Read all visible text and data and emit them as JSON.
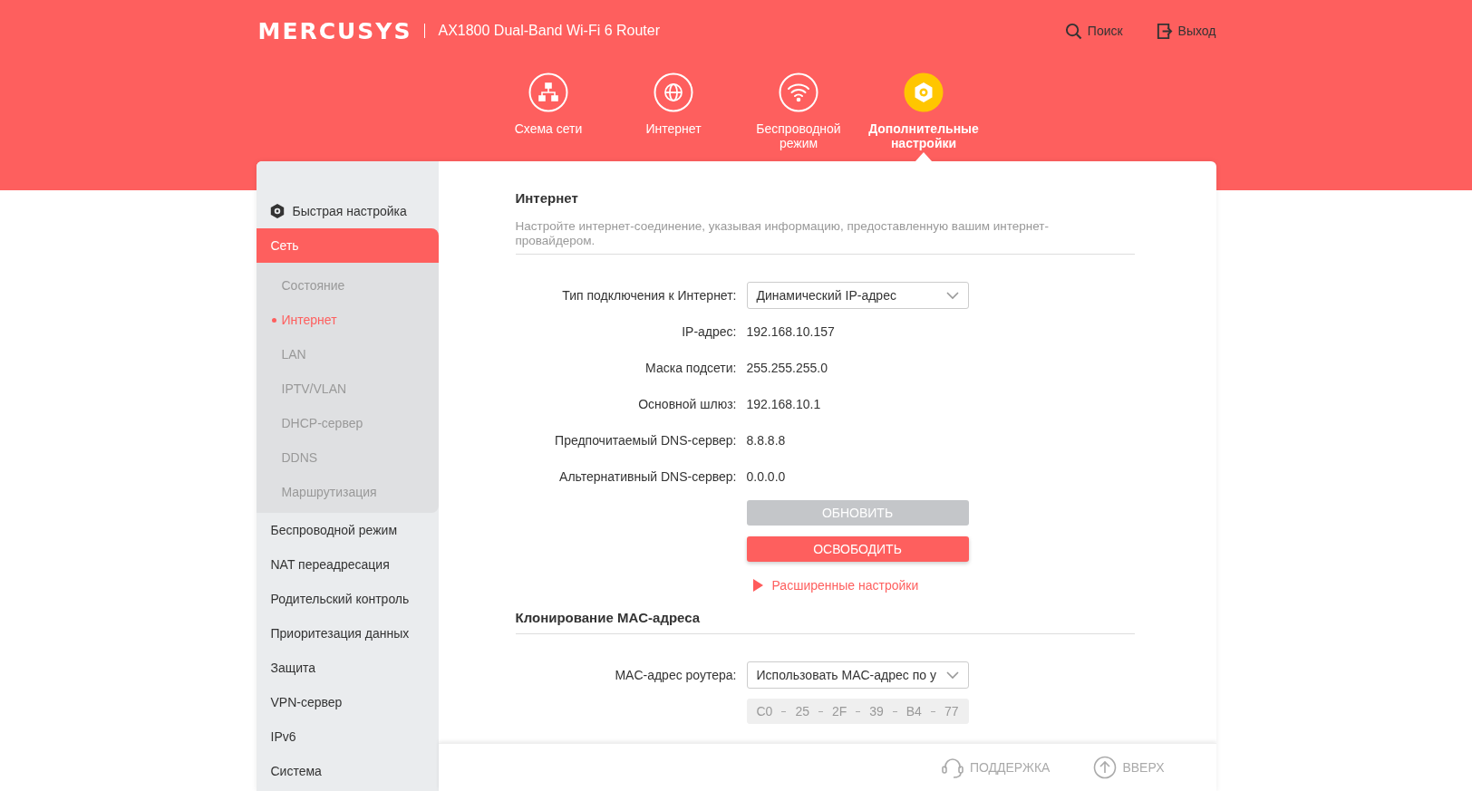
{
  "header": {
    "logo": "MERCUSYS",
    "model": "AX1800 Dual-Band Wi-Fi 6 Router",
    "actions": [
      {
        "kind": "search",
        "label": "Поиск"
      },
      {
        "kind": "logout",
        "label": "Выход"
      }
    ]
  },
  "nav": [
    {
      "kind": "topology",
      "label": "Схема сети",
      "selected": false
    },
    {
      "kind": "globe",
      "label": "Интернет",
      "selected": false
    },
    {
      "kind": "wifi",
      "label": "Беспроводной режим",
      "selected": false
    },
    {
      "kind": "gear",
      "label": "Дополнительные настройки",
      "selected": true
    }
  ],
  "sidebar": {
    "items": [
      {
        "kind": "quick",
        "label": "Быстрая настройка",
        "selected": false
      },
      {
        "kind": "menu",
        "label": "Сеть",
        "selected": true,
        "expanded": true,
        "children": [
          {
            "label": "Состояние",
            "selected": false
          },
          {
            "label": "Интернет",
            "selected": true
          },
          {
            "label": "LAN",
            "selected": false
          },
          {
            "label": "IPTV/VLAN",
            "selected": false
          },
          {
            "label": "DHCP-сервер",
            "selected": false
          },
          {
            "label": "DDNS",
            "selected": false
          },
          {
            "label": "Маршрутизация",
            "selected": false
          }
        ]
      },
      {
        "kind": "menu",
        "label": "Беспроводной режим",
        "selected": false
      },
      {
        "kind": "menu",
        "label": "NAT переадресация",
        "selected": false
      },
      {
        "kind": "menu",
        "label": "Родительский контроль",
        "selected": false
      },
      {
        "kind": "menu",
        "label": "Приоритезация данных",
        "selected": false
      },
      {
        "kind": "menu",
        "label": "Защита",
        "selected": false
      },
      {
        "kind": "menu",
        "label": "VPN-сервер",
        "selected": false
      },
      {
        "kind": "menu",
        "label": "IPv6",
        "selected": false
      },
      {
        "kind": "menu",
        "label": "Система",
        "selected": false
      }
    ]
  },
  "internet": {
    "title": "Интернет",
    "description": "Настройте интернет-соединение, указывая информацию, предоставленную вашим интернет-провайдером.",
    "rows": [
      {
        "kind": "select",
        "label": "Тип подключения к Интернет:",
        "value": "Динамический IP-адрес"
      },
      {
        "kind": "text",
        "label": "IP-адрес:",
        "value": "192.168.10.157"
      },
      {
        "kind": "text",
        "label": "Маска подсети:",
        "value": "255.255.255.0"
      },
      {
        "kind": "text",
        "label": "Основной шлюз:",
        "value": "192.168.10.1"
      },
      {
        "kind": "text",
        "label": "Предпочитаемый DNS-сервер:",
        "value": "8.8.8.8"
      },
      {
        "kind": "text",
        "label": "Альтернативный DNS-сервер:",
        "value": "0.0.0.0"
      }
    ],
    "buttons": [
      {
        "label": "ОБНОВИТЬ",
        "disabled": true
      },
      {
        "label": "ОСВОБОДИТЬ",
        "disabled": false
      }
    ],
    "advanced": {
      "label": "Расширенные настройки",
      "expanded": false
    }
  },
  "mac_clone": {
    "title": "Клонирование MAC-адреса",
    "label": "MAC-адрес роутера:",
    "value": "Использовать MAC-адрес по у",
    "octets": [
      "C0",
      "25",
      "2F",
      "39",
      "B4",
      "77"
    ],
    "disabled": true
  },
  "footer": [
    {
      "kind": "support",
      "label": "ПОДДЕРЖКА"
    },
    {
      "kind": "up",
      "label": "ВВЕРХ"
    }
  ]
}
